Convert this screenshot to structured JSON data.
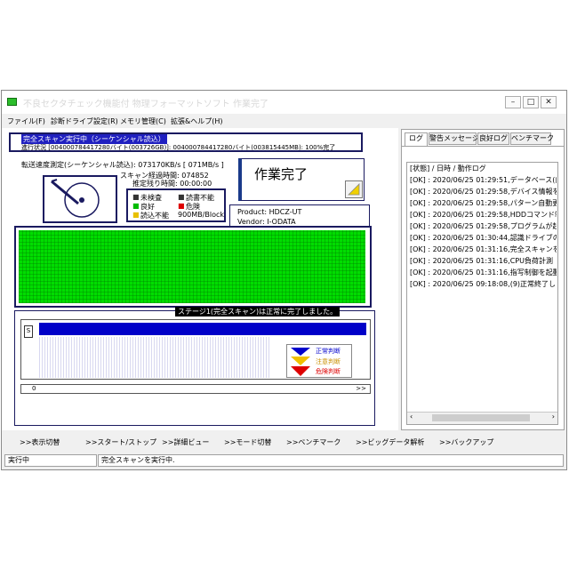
{
  "window": {
    "title": "不良セクタチェック機能付 物理フォーマットソフト 作業完了"
  },
  "window_buttons": {
    "minimize": "–",
    "maximize": "□",
    "close": "✕"
  },
  "menu": [
    "ファイル(F)",
    "診断ドライブ設定(R)",
    "メモリ管理(C)",
    "拡張&ヘルプ(H)"
  ],
  "scan": {
    "title": "完全スキャン実行中（シーケンシャル読込）",
    "progress": "進行状況 [004000784417280バイト(003726GB)]: 004000784417280バイト(003815445MB): 100%完了",
    "transfer": "転送速度測定(シーケンシャル読込): 073170KB/s [ 071MB/s ]",
    "elapsed": "スキャン経過時間: 074852",
    "remaining": "推定残り時間: 00:00:00"
  },
  "legend": {
    "unchecked": "未検査",
    "unreadable": "読書不能",
    "good": "良好",
    "danger": "危険",
    "readerror": "読込不能",
    "block": "900MB/Block"
  },
  "status_card": {
    "text": "作業完了",
    "product": "Product: HDCZ-UT",
    "vendor": "Vendor: I-ODATA"
  },
  "stage": {
    "label": "ステージ1(完全スキャン)は正常に完了しました。",
    "row_label": "S",
    "scroll_start": "0",
    "scroll_end": ">>"
  },
  "judge": {
    "normal": "正常判断",
    "caution": "注意判断",
    "danger": "危険判断"
  },
  "tabs": [
    "ログ",
    "警告メッセージ",
    "良好ログ",
    "ベンチマーク"
  ],
  "log": {
    "header": "[状態] / 日時 / 動作ログ",
    "rows": [
      "[OK] : 2020/06/25 01:29:51,データベース(内",
      "[OK] : 2020/06/25 01:29:58,デバイス情報を読",
      "[OK] : 2020/06/25 01:29:58,パターン自動更",
      "[OK] : 2020/06/25 01:29:58,HDDコマンド制",
      "[OK] : 2020/06/25 01:29:58,プログラムが起動",
      "[OK] : 2020/06/25 01:30:44,認識ドライブの確",
      "[OK] : 2020/06/25 01:31:16,完全スキャンを実",
      "[OK] : 2020/06/25 01:31:16,CPU負荷計測",
      "[OK] : 2020/06/25 01:31:16,指写制御を起動",
      "[OK] : 2020/06/25 09:18:08,(9)正常終了し"
    ]
  },
  "bottom_buttons": [
    ">>表示切替",
    ">>スタート/ストップ",
    ">>詳細ビュー",
    ">>モード切替",
    ">>ベンチマーク",
    ">>ビッグデータ解析",
    ">>バックアップ"
  ],
  "statusbar": {
    "state": "実行中",
    "message": "完全スキャンを実行中."
  },
  "colors": {
    "grid_green": "#00dd00",
    "bar_blue": "#0000c8",
    "normal_blue": "#0000cc",
    "caution_yellow": "#f0c000",
    "danger_red": "#dd0000"
  }
}
